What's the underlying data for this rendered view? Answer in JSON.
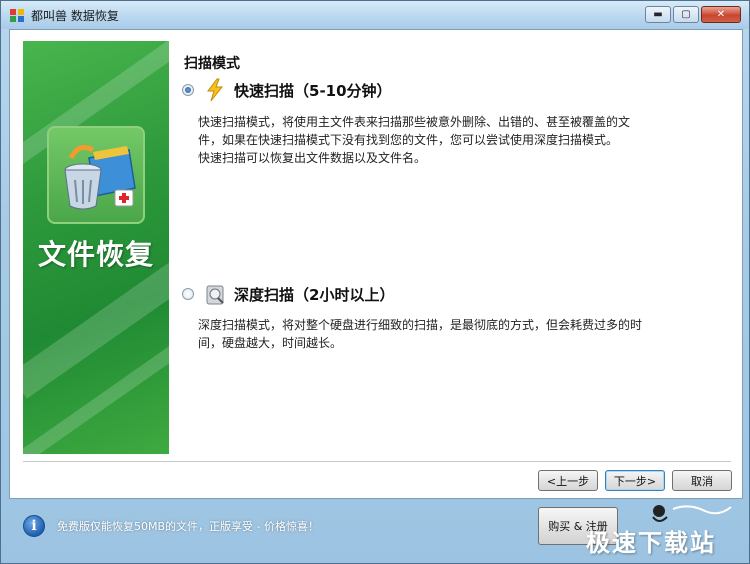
{
  "window": {
    "title": "都叫兽 数据恢复",
    "controls": {
      "minimize": "▬",
      "maximize": "▢",
      "close": "✕"
    }
  },
  "banner": {
    "title": "文件恢复"
  },
  "scan": {
    "section_title": "扫描模式",
    "options": [
      {
        "label": "快速扫描（5-10分钟）",
        "selected": true,
        "icon": "lightning-icon",
        "description": [
          "快速扫描模式，将使用主文件表来扫描那些被意外删除、出错的、甚至被覆盖的文",
          "件，如果在快速扫描模式下没有找到您的文件，您可以尝试使用深度扫描模式。",
          "快速扫描可以恢复出文件数据以及文件名。"
        ]
      },
      {
        "label": "深度扫描（2小时以上）",
        "selected": false,
        "icon": "magnifier-disk-icon",
        "description": [
          "深度扫描模式，将对整个硬盘进行细致的扫描，是最彻底的方式，但会耗费过多的时",
          "间，硬盘越大，时间越长。"
        ]
      }
    ]
  },
  "buttons": {
    "prev": "<上一步",
    "next": "下一步>",
    "cancel": "取消"
  },
  "footer": {
    "info_text": "免费版仅能恢复50MB的文件，正版享受 - 价格惊喜！",
    "buy_button": "购买 & 注册",
    "watermark": "极速下载站"
  },
  "colors": {
    "banner_green": "#2e9a3c",
    "radio_selected": "#23569a",
    "window_frame": "#a7cbe6"
  }
}
